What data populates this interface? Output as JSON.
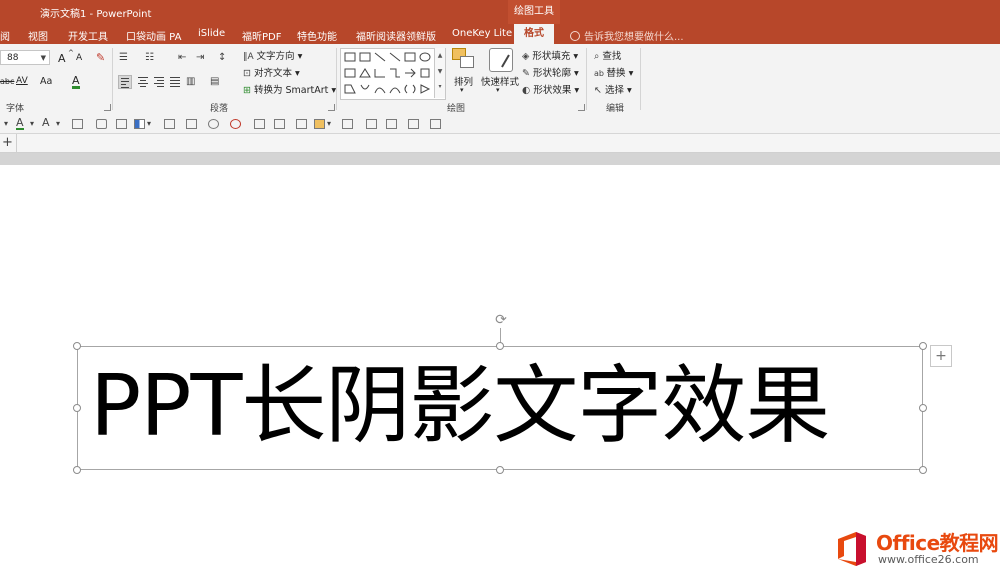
{
  "window": {
    "title": "演示文稿1 - PowerPoint",
    "context_tab_group": "绘图工具"
  },
  "tabs": [
    {
      "label": "阅"
    },
    {
      "label": "视图"
    },
    {
      "label": "开发工具"
    },
    {
      "label": "口袋动画 PA"
    },
    {
      "label": "iSlide"
    },
    {
      "label": "福昕PDF"
    },
    {
      "label": "特色功能"
    },
    {
      "label": "福昕阅读器领鲜版"
    },
    {
      "label": "OneKey Lite"
    },
    {
      "label": "格式",
      "active": true
    }
  ],
  "tell_me": "告诉我您想要做什么...",
  "ribbon": {
    "font": {
      "size_value": "88",
      "grow_label": "A",
      "shrink_label": "A",
      "strike_label": "abc",
      "spacing_label": "AV",
      "case_label": "Aa",
      "color_label": "A",
      "group_label": "字体"
    },
    "paragraph": {
      "text_direction": "文字方向",
      "align_text": "对齐文本",
      "smartart": "转换为 SmartArt",
      "group_label": "段落"
    },
    "drawing": {
      "arrange": "排列",
      "quick_styles": "快速样式",
      "shape_fill": "形状填充",
      "shape_outline": "形状轮廓",
      "shape_effects": "形状效果",
      "group_label": "绘图"
    },
    "editing": {
      "find": "查找",
      "replace": "替换",
      "select": "选择",
      "group_label": "编辑"
    }
  },
  "slide": {
    "text": "PPT长阴影文字效果"
  },
  "watermark": {
    "brand": "Office教程网",
    "url": "www.office26.com",
    "colors": {
      "orange": "#e8490f",
      "red": "#c8102e"
    }
  },
  "colors": {
    "titlebar": "#b7472a",
    "ribbon_bg": "#f3f3f3",
    "active_tab_text": "#b7472a"
  }
}
